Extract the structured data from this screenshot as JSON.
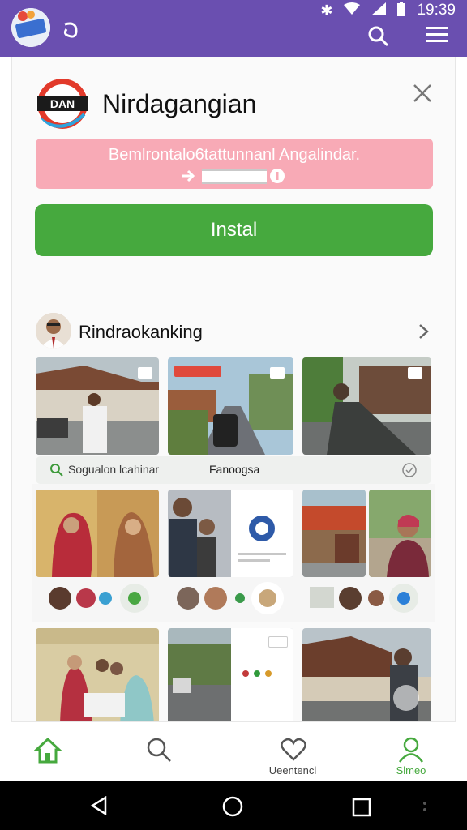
{
  "status_bar": {
    "time": "19:39",
    "icons": [
      "bluetooth-icon",
      "wifi-icon",
      "signal-icon",
      "battery-icon"
    ]
  },
  "top_bar": {
    "actions": [
      "search-icon",
      "menu-icon"
    ]
  },
  "promo": {
    "title": "Nirdagangian",
    "logo_text": "DAN",
    "banner_text": "Bemlrontalo6tattunnanl Angalindar.",
    "install_label": "Instal"
  },
  "section": {
    "title": "Rindraokanking",
    "search_placeholder": "Sogualon lcahinar",
    "search_center": "Fanoogsa"
  },
  "bottom_nav": {
    "items": [
      {
        "icon": "home-icon",
        "label": ""
      },
      {
        "icon": "search-icon",
        "label": ""
      },
      {
        "icon": "heart-icon",
        "label": "Ueentencl"
      },
      {
        "icon": "person-icon",
        "label": "Slmeo"
      }
    ],
    "active_color": "#46a93e"
  },
  "colors": {
    "status_bar": "#6a4fb0",
    "banner": "#f8aab6",
    "install": "#46a93e"
  }
}
